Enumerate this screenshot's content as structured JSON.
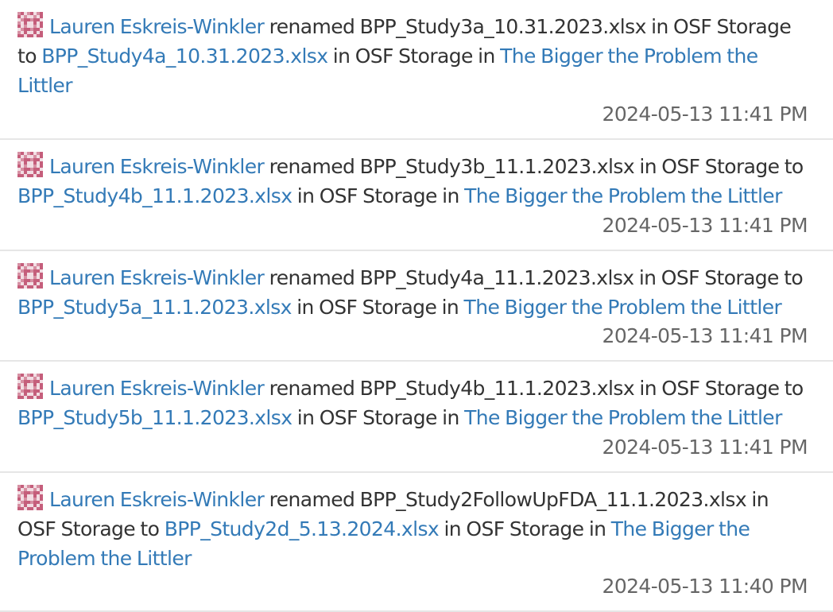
{
  "entries": [
    {
      "user": "Lauren Eskreis-Winkler",
      "verb": " renamed ",
      "old_name": "BPP_Study3a_10.31.2023.xlsx",
      "in_storage_1": " in OSF Storage to ",
      "new_name": "BPP_Study4a_10.31.2023.xlsx",
      "in_storage_2": " in OSF Storage in ",
      "project": "The Bigger the Problem the Littler",
      "timestamp": "2024-05-13 11:41 PM"
    },
    {
      "user": "Lauren Eskreis-Winkler",
      "verb": " renamed ",
      "old_name": "BPP_Study3b_11.1.2023.xlsx",
      "in_storage_1": " in OSF Storage to ",
      "new_name": "BPP_Study4b_11.1.2023.xlsx",
      "in_storage_2": " in OSF Storage in ",
      "project": "The Bigger the Problem the Littler",
      "timestamp": "2024-05-13 11:41 PM"
    },
    {
      "user": "Lauren Eskreis-Winkler",
      "verb": " renamed ",
      "old_name": "BPP_Study4a_11.1.2023.xlsx",
      "in_storage_1": " in OSF Storage to ",
      "new_name": "BPP_Study5a_11.1.2023.xlsx",
      "in_storage_2": " in OSF Storage in ",
      "project": "The Bigger the Problem the Littler",
      "timestamp": "2024-05-13 11:41 PM"
    },
    {
      "user": "Lauren Eskreis-Winkler",
      "verb": " renamed ",
      "old_name": "BPP_Study4b_11.1.2023.xlsx",
      "in_storage_1": " in OSF Storage to ",
      "new_name": "BPP_Study5b_11.1.2023.xlsx",
      "in_storage_2": " in OSF Storage in ",
      "project": "The Bigger the Problem the Littler",
      "timestamp": "2024-05-13 11:41 PM"
    },
    {
      "user": "Lauren Eskreis-Winkler",
      "verb": " renamed ",
      "old_name": "BPP_Study2FollowUpFDA_11.1.2023.xlsx",
      "in_storage_1": " in OSF Storage to ",
      "new_name": "BPP_Study2d_5.13.2024.xlsx",
      "in_storage_2": " in OSF Storage in ",
      "project": "The Bigger the Problem the Littler",
      "timestamp": "2024-05-13 11:40 PM"
    }
  ],
  "colors": {
    "link": "#337ab7",
    "text": "#333333",
    "timestamp": "#666666",
    "avatar_primary": "#c0506f",
    "avatar_bg": "#f2dde3"
  },
  "icons": {
    "avatar": "identicon-avatar-icon"
  }
}
